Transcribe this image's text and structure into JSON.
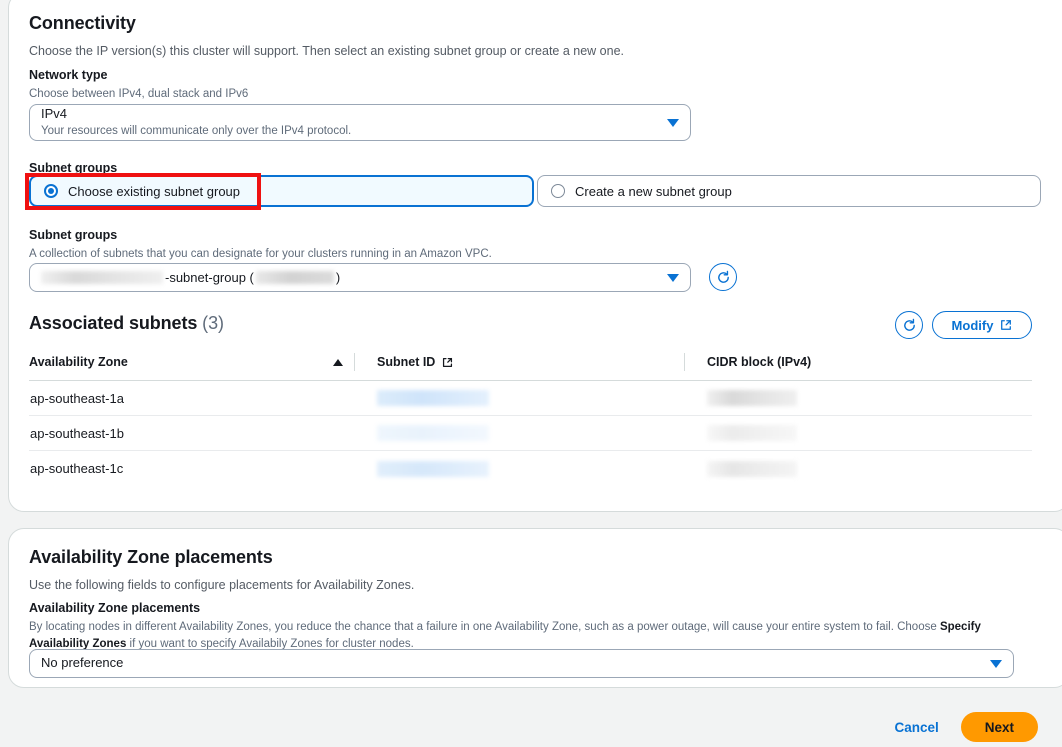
{
  "connectivity": {
    "title": "Connectivity",
    "description": "Choose the IP version(s) this cluster will support. Then select an existing subnet group or create a new one.",
    "network_type": {
      "label": "Network type",
      "hint": "Choose between IPv4, dual stack and IPv6",
      "selected_value": "IPv4",
      "selected_sub": "Your resources will communicate only over the IPv4 protocol.",
      "options": [
        "IPv4",
        "Dual stack",
        "IPv6"
      ]
    },
    "subnet_groups_choice": {
      "label": "Subnet groups",
      "option_existing": "Choose existing subnet group",
      "option_new": "Create a new subnet group",
      "selected": "existing"
    },
    "subnet_group_select": {
      "label": "Subnet groups",
      "hint": "A collection of subnets that you can designate for your clusters running in an Amazon VPC.",
      "value_suffix": "-subnet-group (",
      "value_close": ")",
      "redacted": true,
      "refresh_icon": "refresh-icon"
    },
    "associated_subnets": {
      "title": "Associated subnets",
      "count": "(3)",
      "refresh_icon": "refresh-icon",
      "modify_label": "Modify",
      "modify_icon": "external-link-icon",
      "columns": [
        {
          "label": "Availability Zone",
          "sort": "asc",
          "icon": null
        },
        {
          "label": "Subnet ID",
          "sort": "none",
          "icon": "external-link-icon"
        },
        {
          "label": "CIDR block (IPv4)",
          "sort": "none",
          "icon": null
        }
      ],
      "rows": [
        {
          "az": "ap-southeast-1a",
          "subnet_id": "",
          "cidr": "",
          "redacted": true
        },
        {
          "az": "ap-southeast-1b",
          "subnet_id": "",
          "cidr": "",
          "redacted": true
        },
        {
          "az": "ap-southeast-1c",
          "subnet_id": "",
          "cidr": "",
          "redacted": true
        }
      ]
    }
  },
  "az_placements": {
    "title": "Availability Zone placements",
    "description": "Use the following fields to configure placements for Availability Zones.",
    "field_label": "Availability Zone placements",
    "hint_part1": "By locating nodes in different Availability Zones, you reduce the chance that a failure in one Availability Zone, such as a power outage, will cause your entire system to fail. Choose ",
    "hint_bold": "Specify Availability Zones",
    "hint_part2": " if you want to specify Availabily Zones for cluster nodes.",
    "selected_value": "No preference",
    "options": [
      "No preference",
      "Specify Availability Zones"
    ]
  },
  "footer": {
    "cancel_label": "Cancel",
    "next_label": "Next"
  },
  "colors": {
    "accent_blue": "#0972d3",
    "primary_orange": "#ff9900",
    "annotation_red": "#ef1111",
    "text_dark": "#16191f",
    "text_muted": "#5f6b7a",
    "page_bg": "#f2f3f3",
    "selected_tile_bg": "#f1faff"
  }
}
